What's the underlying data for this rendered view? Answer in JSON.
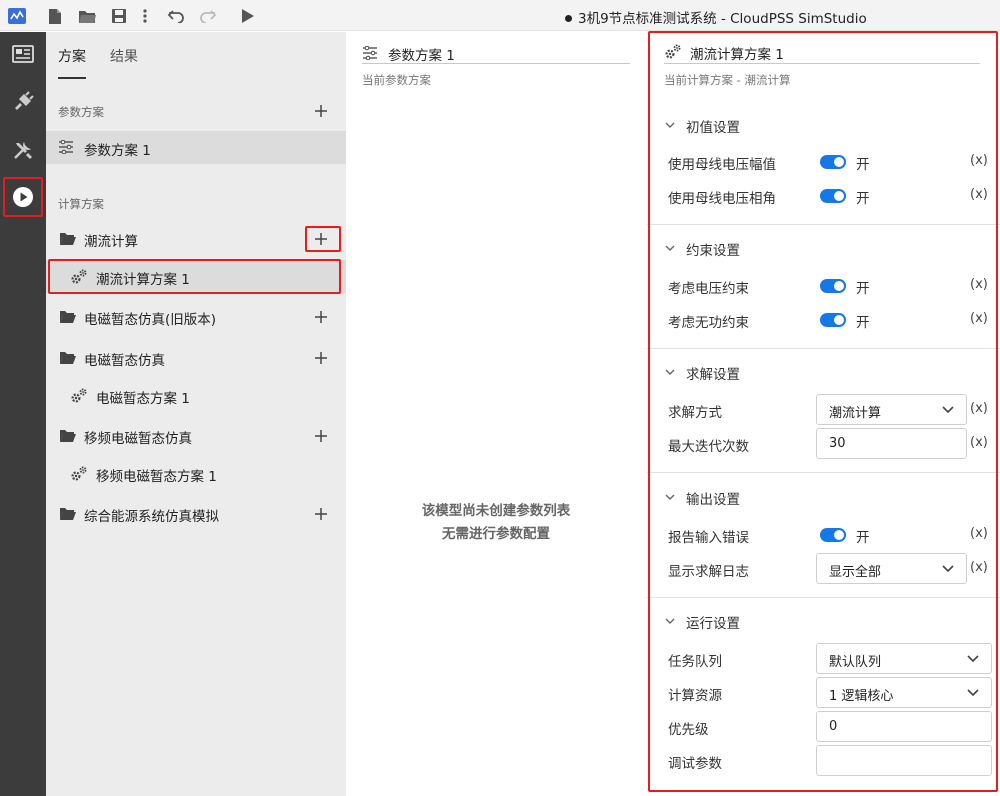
{
  "app": {
    "window_title": "3机9节点标准测试系统 - CloudPSS SimStudio",
    "toolbar_icons": [
      "app-logo-icon",
      "new-file-icon",
      "open-folder-icon",
      "save-icon",
      "more-icon",
      "undo-icon",
      "redo-icon",
      "run-icon"
    ],
    "activity_icons": [
      "overview-icon",
      "plugin-icon",
      "tools-icon",
      "run-icon"
    ]
  },
  "sidebar": {
    "tabs": [
      {
        "label": "方案"
      },
      {
        "label": "结果"
      }
    ],
    "param_section": {
      "label": "参数方案",
      "items": [
        {
          "label": "参数方案 1"
        }
      ]
    },
    "calc_section": {
      "label": "计算方案",
      "groups": [
        {
          "label": "潮流计算",
          "children": [
            {
              "label": "潮流计算方案 1"
            }
          ]
        },
        {
          "label": "电磁暂态仿真(旧版本)",
          "children": []
        },
        {
          "label": "电磁暂态仿真",
          "children": [
            {
              "label": "电磁暂态方案 1"
            }
          ]
        },
        {
          "label": "移频电磁暂态仿真",
          "children": [
            {
              "label": "移频电磁暂态方案 1"
            }
          ]
        },
        {
          "label": "综合能源系统仿真模拟",
          "children": []
        }
      ]
    }
  },
  "middle": {
    "title": "参数方案 1",
    "subtitle": "当前参数方案",
    "empty_line1": "该模型尚未创建参数列表",
    "empty_line2": "无需进行参数配置"
  },
  "right": {
    "title": "潮流计算方案 1",
    "subtitle": "当前计算方案 - 潮流计算",
    "groups": [
      {
        "label": "初值设置",
        "fields": [
          {
            "label": "使用母线电压幅值",
            "type": "toggle",
            "value": "开",
            "on": true
          },
          {
            "label": "使用母线电压相角",
            "type": "toggle",
            "value": "开",
            "on": true
          }
        ]
      },
      {
        "label": "约束设置",
        "fields": [
          {
            "label": "考虑电压约束",
            "type": "toggle",
            "value": "开",
            "on": true
          },
          {
            "label": "考虑无功约束",
            "type": "toggle",
            "value": "开",
            "on": true
          }
        ]
      },
      {
        "label": "求解设置",
        "fields": [
          {
            "label": "求解方式",
            "type": "select",
            "value": "潮流计算"
          },
          {
            "label": "最大迭代次数",
            "type": "input",
            "value": "30"
          }
        ]
      },
      {
        "label": "输出设置",
        "fields": [
          {
            "label": "报告输入错误",
            "type": "toggle",
            "value": "开",
            "on": true
          },
          {
            "label": "显示求解日志",
            "type": "select",
            "value": "显示全部"
          }
        ]
      },
      {
        "label": "运行设置",
        "fields": [
          {
            "label": "任务队列",
            "type": "select",
            "value": "默认队列"
          },
          {
            "label": "计算资源",
            "type": "select",
            "value": "1 逻辑核心"
          },
          {
            "label": "优先级",
            "type": "input",
            "value": "0"
          },
          {
            "label": "调试参数",
            "type": "input",
            "value": ""
          }
        ]
      }
    ],
    "expr_label": "(x)"
  },
  "colors": {
    "highlight": "#e02020",
    "toggle_on": "#1677e6",
    "activity_bar": "#3c3c3c",
    "sidebar_bg": "#ececec"
  }
}
